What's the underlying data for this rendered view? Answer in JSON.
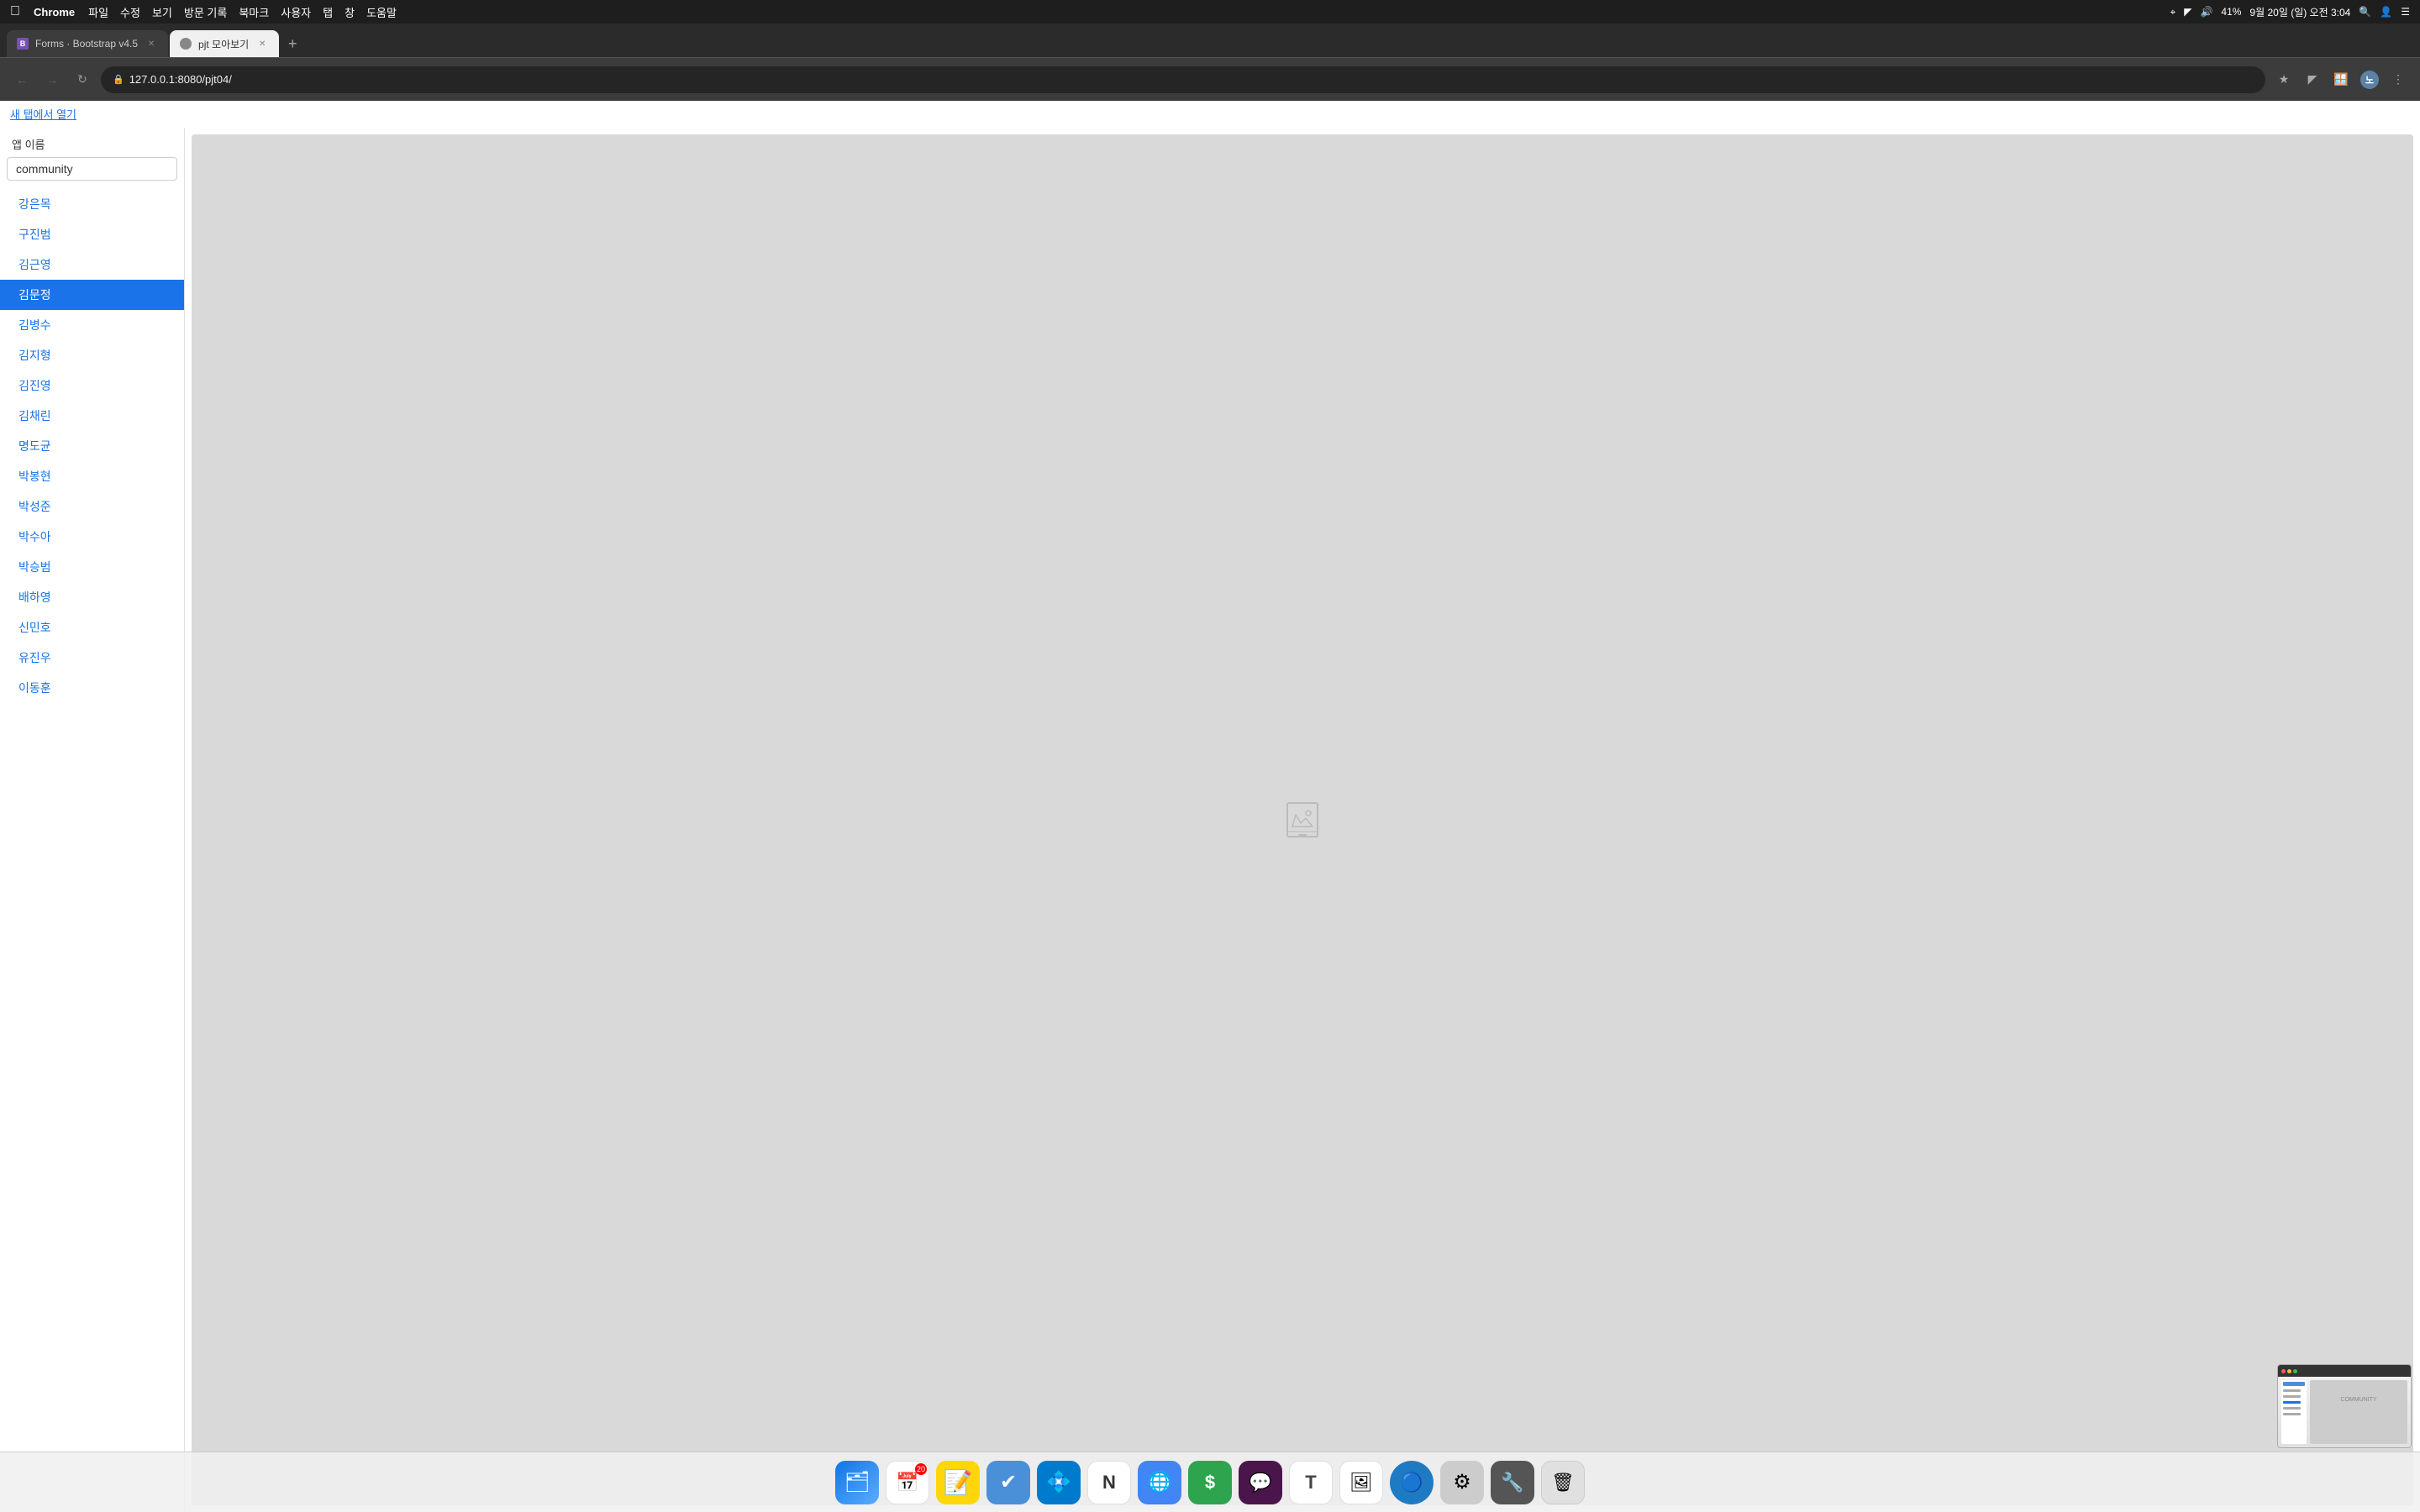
{
  "menubar": {
    "apple": "🍎",
    "chrome": "Chrome",
    "items": [
      "파일",
      "수정",
      "보기",
      "방문 기록",
      "북마크",
      "사용자",
      "탭",
      "창",
      "도움말"
    ],
    "right": {
      "battery": "41%",
      "time": "9월 20일 (일) 오전 3:04"
    }
  },
  "tabs": [
    {
      "id": "tab-bootstrap",
      "label": "Forms · Bootstrap v4.5",
      "favicon_type": "bootstrap",
      "active": false
    },
    {
      "id": "tab-pjt",
      "label": "pjt 모아보기",
      "favicon_type": "pjt",
      "active": true
    }
  ],
  "address": {
    "url": "127.0.0.1:8080/pjt04/"
  },
  "page": {
    "open_new_tab": "새 탭에서 열기",
    "sidebar_label": "앱 이름",
    "app_name_input": "community",
    "nav_items": [
      {
        "label": "강은목",
        "active": false
      },
      {
        "label": "구진범",
        "active": false
      },
      {
        "label": "김근영",
        "active": false
      },
      {
        "label": "김문정",
        "active": true
      },
      {
        "label": "김병수",
        "active": false
      },
      {
        "label": "김지형",
        "active": false
      },
      {
        "label": "김진영",
        "active": false
      },
      {
        "label": "김채린",
        "active": false
      },
      {
        "label": "명도균",
        "active": false
      },
      {
        "label": "박봉현",
        "active": false
      },
      {
        "label": "박성준",
        "active": false
      },
      {
        "label": "박수아",
        "active": false
      },
      {
        "label": "박승범",
        "active": false
      },
      {
        "label": "배하영",
        "active": false
      },
      {
        "label": "신민호",
        "active": false
      },
      {
        "label": "유진우",
        "active": false
      },
      {
        "label": "이동훈",
        "active": false
      }
    ]
  },
  "dock": {
    "items": [
      {
        "id": "finder",
        "emoji": "🗂",
        "color": "#1175e6",
        "label": "Finder"
      },
      {
        "id": "calendar",
        "emoji": "📅",
        "color": "#fff",
        "label": "Calendar",
        "badge": "20"
      },
      {
        "id": "notes",
        "emoji": "📝",
        "color": "#ffd60a",
        "label": "Notes"
      },
      {
        "id": "tasks",
        "emoji": "✔",
        "color": "#4a90d9",
        "label": "Tasks"
      },
      {
        "id": "vscode",
        "emoji": "💠",
        "color": "#007acc",
        "label": "VS Code"
      },
      {
        "id": "notion",
        "emoji": "N",
        "color": "#fff",
        "label": "Notion"
      },
      {
        "id": "chrome",
        "emoji": "🌐",
        "color": "#4285f4",
        "label": "Chrome"
      },
      {
        "id": "dollar",
        "emoji": "$",
        "color": "#2ea44f",
        "label": "Dollar"
      },
      {
        "id": "slack",
        "emoji": "💬",
        "color": "#4a154b",
        "label": "Slack"
      },
      {
        "id": "typora",
        "emoji": "T",
        "color": "#fff",
        "label": "Typora"
      },
      {
        "id": "photos",
        "emoji": "🖼",
        "color": "#fff",
        "label": "Photos"
      },
      {
        "id": "istatmenus",
        "emoji": "🔵",
        "color": "#1e7ac3",
        "label": "iStatMenus"
      },
      {
        "id": "systemprefs",
        "emoji": "⚙",
        "color": "#888",
        "label": "System Prefs"
      },
      {
        "id": "devtools",
        "emoji": "🔧",
        "color": "#555",
        "label": "DevTools"
      },
      {
        "id": "trash",
        "emoji": "🗑",
        "color": "#888",
        "label": "Trash"
      }
    ]
  }
}
